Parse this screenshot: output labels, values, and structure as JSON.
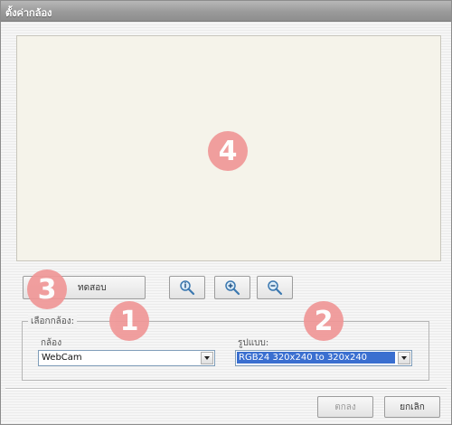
{
  "window": {
    "title": "ตั้งค่ากล้อง"
  },
  "toolbar": {
    "test_label": "ทดสอบ",
    "zoom_fit_icon": "magnifier-fit-icon",
    "zoom_in_icon": "magnifier-plus-icon",
    "zoom_out_icon": "magnifier-minus-icon"
  },
  "camera_settings": {
    "group_label": "เลือกกล้อง:",
    "camera_label": "กล้อง",
    "camera_value": "WebCam",
    "format_label": "รูปแบบ:",
    "format_value": "RGB24 320x240 to 320x240"
  },
  "footer": {
    "ok_label": "ตกลง",
    "cancel_label": "ยกเลิก"
  },
  "annotations": {
    "one": "1",
    "two": "2",
    "three": "3",
    "four": "4"
  },
  "colors": {
    "badge": "#f09797",
    "selection": "#3a6fd0",
    "preview_bg": "#f5f3ea"
  }
}
